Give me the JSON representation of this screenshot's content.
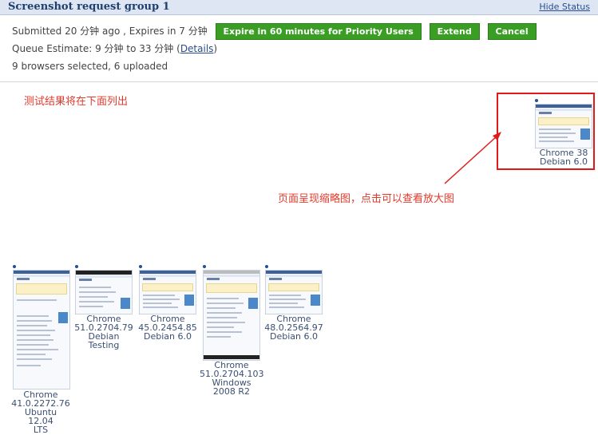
{
  "header": {
    "title": "Screenshot request group 1",
    "hide_status": "Hide Status"
  },
  "status": {
    "submitted": "Submitted 20 分钟 ago , Expires in 7 分钟",
    "buttons": {
      "expire": "Expire in 60 minutes for Priority Users",
      "extend": "Extend",
      "cancel": "Cancel"
    },
    "queue_prefix": "Queue Estimate: 9 分钟 to 33 分钟 (",
    "queue_link": "Details",
    "queue_suffix": ")",
    "browsers": "9 browsers selected, 6 uploaded"
  },
  "annotations": {
    "note_top": "测试结果将在下面列出",
    "note_thumb": "页面呈现缩略图，点击可以查看放大图",
    "box_color": "#e01a1a",
    "text_color": "#e23a2c"
  },
  "screenshots": [
    {
      "browser": "Chrome 38",
      "platform": "Debian 6.0"
    },
    {
      "browser": "Chrome",
      "version": "41.0.2272.76",
      "platform": "Ubuntu 12.04",
      "platform2": "LTS"
    },
    {
      "browser": "Chrome",
      "version": "51.0.2704.79",
      "platform": "Debian Testing"
    },
    {
      "browser": "Chrome",
      "version": "45.0.2454.85",
      "platform": "Debian 6.0"
    },
    {
      "browser": "Chrome",
      "version": "51.0.2704.103",
      "platform": "Windows",
      "platform2": "2008 R2"
    },
    {
      "browser": "Chrome",
      "version": "48.0.2564.97",
      "platform": "Debian 6.0"
    }
  ],
  "colors": {
    "button_green": "#3a9e25",
    "header_bg": "#dde6f2",
    "link": "#2a4d8f"
  }
}
